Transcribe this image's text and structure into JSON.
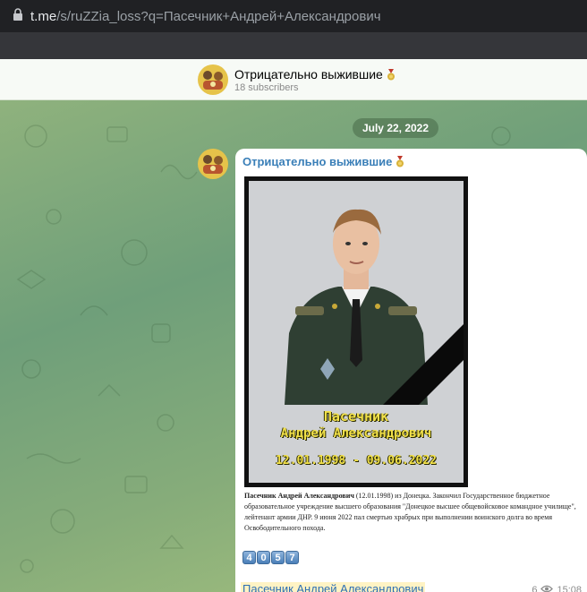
{
  "browser": {
    "domain": "t.me",
    "path": "/s/ruZZia_loss?q=Пасечник+Андрей+Александрович"
  },
  "channel": {
    "title": "Отрицательно выжившие",
    "subscribers": "18 subscribers"
  },
  "chat": {
    "date_separator": "July 22, 2022"
  },
  "post": {
    "author": "Отрицательно выжившие",
    "photo": {
      "surname": "Пасечник",
      "given_names": "Андрей Александрович",
      "dates": "12.01.1998 - 09.06.2022"
    },
    "caption_name": "Пасечник Андрей Александрович",
    "caption_text": " (12.01.1998) из Донецка. Закончил Государственное бюджетное образовательное учреждение высшего образования \"Донецкое высшее общевойсковое командное училище\", лейтенант армии ДНР. 9 июня 2022 пал смертью храбрых при выполнении воинского долга во время Освободительного похода.",
    "counter_digits": [
      "4",
      "0",
      "5",
      "7"
    ],
    "hashtag": "Пасечник Андрей Александрович",
    "views": "6",
    "time": "15:08"
  },
  "colors": {
    "link_blue": "#3a7fb8",
    "chat_green": "#7fa86e",
    "medal_gold": "#d8b23a",
    "medal_ribbon": "#c0392b"
  },
  "icons": [
    "lock-icon",
    "medal-icon",
    "eye-icon",
    "channel-avatar"
  ]
}
